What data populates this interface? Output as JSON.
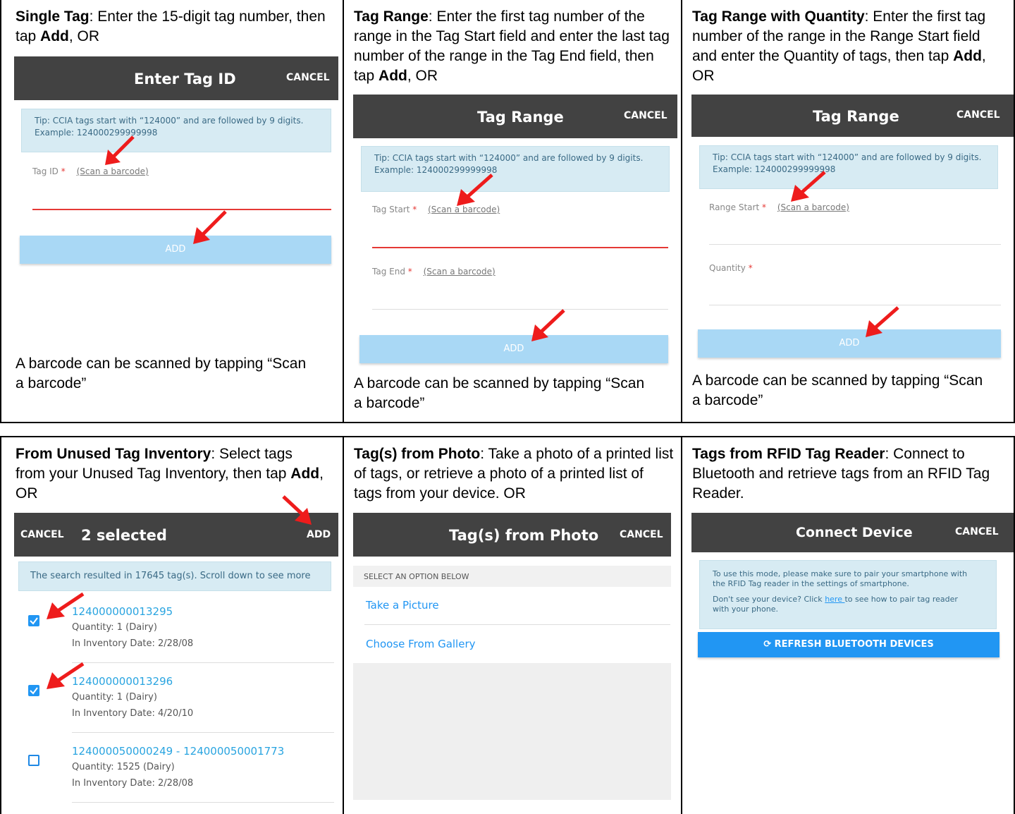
{
  "cells": {
    "single": {
      "heading": "Single Tag",
      "text1": ": Enter the 15-digit tag number, then tap ",
      "add": "Add",
      "text2": ", OR",
      "screen": {
        "title": "Enter Tag ID",
        "cancel": "CANCEL",
        "tip_line1": "Tip: CCIA tags start with “124000” and are followed by 9 digits.",
        "tip_line2": "Example: 124000299999998",
        "field_label": "Tag ID",
        "req": "*",
        "scan": "(Scan a barcode)",
        "add_button": "ADD"
      },
      "caption": "A barcode can be scanned by tapping “Scan a barcode”"
    },
    "range": {
      "heading": "Tag Range",
      "text1": ": Enter the first tag number of the range in the Tag Start field and enter the last tag number of the range in the Tag End field, then tap ",
      "add": "Add",
      "text2": ", OR",
      "screen": {
        "title": "Tag Range",
        "cancel": "CANCEL",
        "tip_line1": "Tip: CCIA tags start with “124000” and are followed by 9 digits.",
        "tip_line2": "Example: 124000299999998",
        "field1_label": "Tag Start",
        "field2_label": "Tag End",
        "req": "*",
        "scan": "(Scan a barcode)",
        "add_button": "ADD"
      },
      "caption": "A barcode can be scanned by tapping “Scan a barcode”"
    },
    "range_qty": {
      "heading": "Tag Range with Quantity",
      "text1": ": Enter the first tag number of the range in the Range Start field and enter the Quantity of tags, then tap ",
      "add": "Add",
      "text2": ", OR",
      "screen": {
        "title": "Tag Range",
        "cancel": "CANCEL",
        "tip_line1": "Tip: CCIA tags start with “124000” and are followed by 9 digits.",
        "tip_line2": "Example: 124000299999998",
        "field1_label": "Range Start",
        "field2_label": "Quantity",
        "req": "*",
        "scan": "(Scan a barcode)",
        "add_button": "ADD"
      },
      "caption": "A barcode can be scanned by tapping “Scan a barcode”"
    },
    "inventory": {
      "heading": "From Unused Tag Inventory",
      "text1": ": Select tags from your Unused Tag Inventory, then tap ",
      "add": "Add",
      "text2": ", OR",
      "screen": {
        "cancel": "CANCEL",
        "title": "2 selected",
        "add": "ADD",
        "tip": "The search resulted in 17645 tag(s). Scroll down to see more",
        "items": [
          {
            "num": "124000000013295",
            "qty": "Quantity: 1 (Dairy)",
            "date": "In Inventory Date: 2/28/08",
            "checked": true
          },
          {
            "num": "124000000013296",
            "qty": "Quantity: 1 (Dairy)",
            "date": "In Inventory Date: 4/20/10",
            "checked": true
          },
          {
            "num": "124000050000249 - 124000050001773",
            "qty": "Quantity: 1525 (Dairy)",
            "date": "In Inventory Date: 2/28/08",
            "checked": false
          }
        ]
      }
    },
    "photo": {
      "heading": "Tag(s) from Photo",
      "text1": ": Take a photo of a printed list of tags, or retrieve a photo of a printed list of tags from your device. OR",
      "screen": {
        "title": "Tag(s) from Photo",
        "cancel": "CANCEL",
        "section": "SELECT AN OPTION BELOW",
        "option1": "Take a Picture",
        "option2": "Choose From Gallery"
      }
    },
    "rfid": {
      "heading": "Tags from RFID Tag Reader",
      "text1": ": Connect to Bluetooth and retrieve tags from an RFID Tag Reader.",
      "screen": {
        "title": "Connect Device",
        "cancel": "CANCEL",
        "tip_line1": "To use this mode, please make sure to pair your smartphone with",
        "tip_line2": "the RFID Tag reader in the settings of smartphone.",
        "tip_line3a": "Don't see your device? Click ",
        "tip_link": "here ",
        "tip_line3b": "to see how to pair tag reader",
        "tip_line4": "with your phone.",
        "refresh": "⟳ REFRESH BLUETOOTH DEVICES"
      }
    }
  },
  "colors": {
    "topbar": "#424242",
    "tip_bg": "#d7ebf3",
    "add_btn": "#a9d8f5",
    "link_blue": "#29a4e0",
    "error_red": "#e53935",
    "arrow_red": "#ee1c1c"
  }
}
